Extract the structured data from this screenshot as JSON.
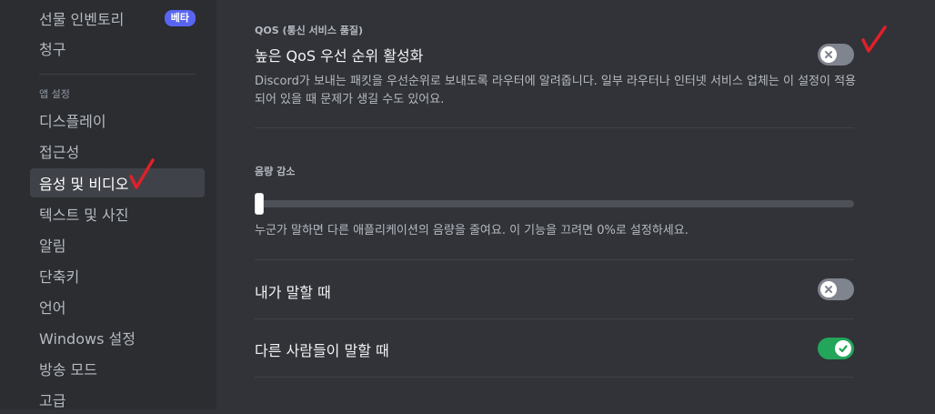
{
  "sidebar": {
    "items": [
      {
        "label": "선물 인벤토리",
        "badge": "베타"
      },
      {
        "label": "청구"
      }
    ],
    "app_settings_header": "앱 설정",
    "app_items": [
      {
        "label": "디스플레이"
      },
      {
        "label": "접근성"
      },
      {
        "label": "음성 및 비디오",
        "active": true
      },
      {
        "label": "텍스트 및 사진"
      },
      {
        "label": "알림"
      },
      {
        "label": "단축키"
      },
      {
        "label": "언어"
      },
      {
        "label": "Windows 설정"
      },
      {
        "label": "방송 모드"
      },
      {
        "label": "고급"
      }
    ]
  },
  "qos": {
    "section_header": "QOS (통신 서비스 품질)",
    "title": "높은 QoS 우선 순위 활성화",
    "description": "Discord가 보내는 패킷을 우선순위로 보내도록 라우터에 알려줍니다. 일부 라우터나 인터넷 서비스 업체는 이 설정이 적용되어 있을 때 문제가 생길 수도 있어요.",
    "enabled": false
  },
  "attenuation": {
    "section_header": "음량 감소",
    "value_percent": 0,
    "description": "누군가 말하면 다른 애플리케이션의 음량을 줄여요. 이 기능을 끄려면 0%로 설정하세요."
  },
  "when_i_speak": {
    "label": "내가 말할 때",
    "enabled": false
  },
  "when_others_speak": {
    "label": "다른 사람들이 말할 때",
    "enabled": true
  },
  "colors": {
    "toggle_on": "#23a55a",
    "toggle_off": "#80848e",
    "badge": "#5865f2",
    "annotation": "#e0202a"
  }
}
